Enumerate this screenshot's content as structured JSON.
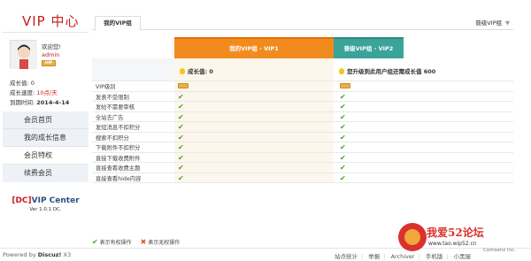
{
  "sidebar": {
    "title": "VIP 中心",
    "welcome": "欢迎您!",
    "username": "admin",
    "vip_badge": "VIP",
    "stats": [
      {
        "label": "成长值: ",
        "value": "0"
      },
      {
        "label": "成长速度: ",
        "value": "10点/天"
      },
      {
        "label": "到期时间: ",
        "value": "2014-4-14"
      }
    ],
    "menu": [
      "会员首页",
      "我的成长信息",
      "会员特权",
      "续费会员"
    ],
    "active_menu_index": 2,
    "credit_title_prefix": "[DC]",
    "credit_title": "VIP Center",
    "credit_version": "Ver 1.0.1 DC."
  },
  "main": {
    "tab_label": "我的VIP组",
    "selector_label": "晋级VIP组",
    "selector_arrow": "▼",
    "col1_header": "我的VIP组 - VIP1",
    "col2_header": "晋级VIP组 - VIP2",
    "col1_growth": "成长值: 0",
    "col2_growth": "您升级到此用户组还需成长值 600",
    "rows": [
      {
        "label": "VIP级别"
      },
      {
        "label": "发表不受限制"
      },
      {
        "label": "发帖不需要审核"
      },
      {
        "label": "全站去广告"
      },
      {
        "label": "发短消息不扣积分"
      },
      {
        "label": "搜索不扣积分"
      },
      {
        "label": "下载附件不扣积分"
      },
      {
        "label": "直接下载收费附件"
      },
      {
        "label": "直接查看收费主题"
      },
      {
        "label": "直接查看hide内容"
      }
    ],
    "check_symbol": "✔",
    "legend_yes": "表示有权操作",
    "legend_no": "表示无权操作",
    "legend_no_symbol": "✖"
  },
  "footer": {
    "powered_prefix": "Powered by ",
    "powered_brand": "Discuz!",
    "powered_version": " X3",
    "links": [
      "站点统计",
      "举报",
      "Archiver",
      "手机版",
      "小黑屋"
    ],
    "copyright": "Comsenz Inc."
  },
  "watermark": {
    "text": "我爱52论坛",
    "url": "www.tao.wip52.cn"
  },
  "colors": {
    "accent_red": "#c81d1d",
    "vip1_orange": "#f28b1e",
    "vip2_teal": "#3aa39a",
    "check_green": "#4aa32b"
  }
}
